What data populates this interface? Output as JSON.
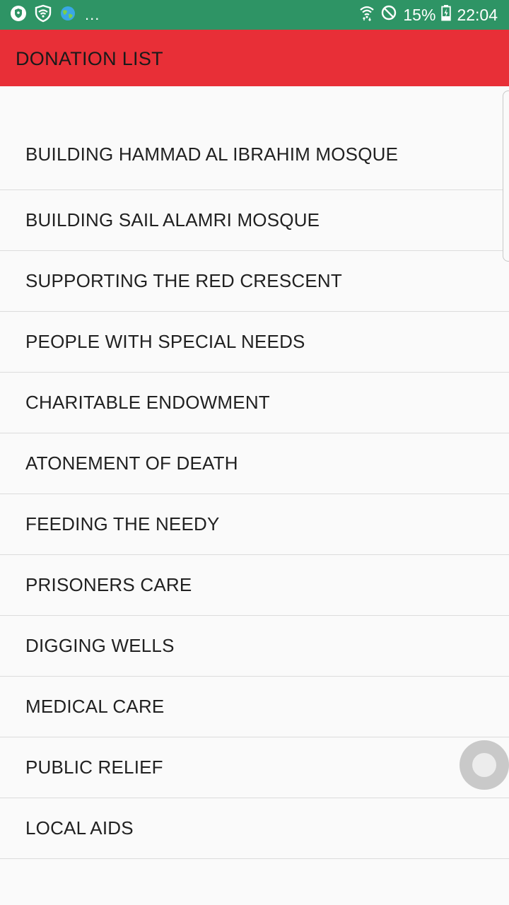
{
  "status_bar": {
    "dots": "...",
    "battery": "15%",
    "time": "22:04",
    "color": "#2e9465"
  },
  "app_bar": {
    "title": "DONATION LIST",
    "color": "#e82f37"
  },
  "donations": [
    "BUILDING HAMMAD AL IBRAHIM MOSQUE",
    "BUILDING SAIL ALAMRI MOSQUE",
    "SUPPORTING THE RED CRESCENT",
    "PEOPLE WITH SPECIAL NEEDS",
    "CHARITABLE ENDOWMENT",
    "ATONEMENT OF DEATH",
    "FEEDING THE NEEDY",
    "PRISONERS CARE",
    "DIGGING WELLS",
    "MEDICAL CARE",
    "PUBLIC RELIEF",
    "LOCAL AIDS"
  ],
  "icons": {
    "status_left": [
      "shield-icon",
      "wifi-shield-icon",
      "globe-icon"
    ],
    "status_right": [
      "wifi-icon",
      "do-not-disturb-icon",
      "battery-charging-icon"
    ]
  }
}
